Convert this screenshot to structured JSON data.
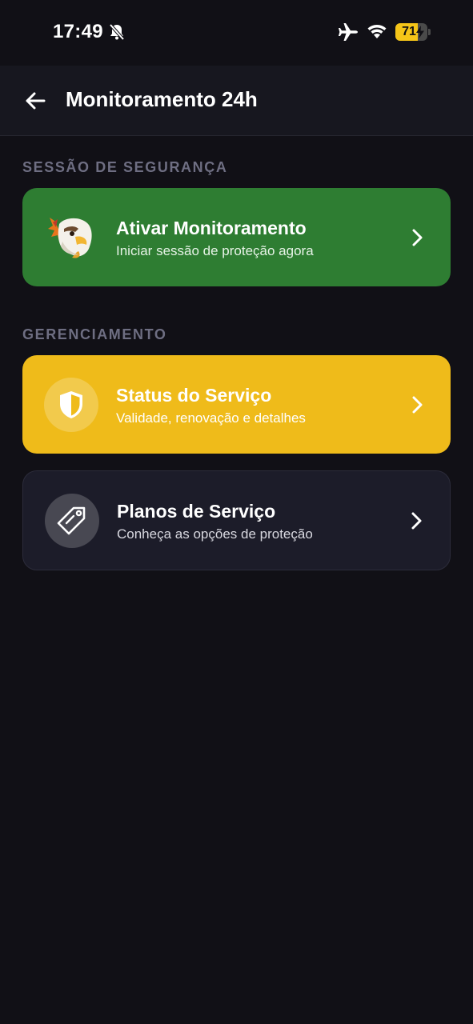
{
  "status_bar": {
    "time": "17:49",
    "battery_level": "71",
    "icons": [
      "bell-muted-icon",
      "airplane-icon",
      "wifi-icon",
      "battery-charging-icon"
    ]
  },
  "header": {
    "title": "Monitoramento 24h"
  },
  "sections": {
    "security": {
      "label": "SESSÃO DE SEGURANÇA",
      "card": {
        "title": "Ativar Monitoramento",
        "subtitle": "Iniciar sessão de proteção agora",
        "color": "#2e7d32",
        "icon": "eagle-logo-icon"
      }
    },
    "management": {
      "label": "GERENCIAMENTO",
      "cards": [
        {
          "title": "Status do Serviço",
          "subtitle": "Validade, renovação e detalhes",
          "color": "#efbb1a",
          "icon": "shield-icon"
        },
        {
          "title": "Planos de Serviço",
          "subtitle": "Conheça as opções de proteção",
          "color": "#1c1c29",
          "icon": "tag-icon"
        }
      ]
    }
  },
  "colors": {
    "background": "#111016",
    "header": "#17171f",
    "section_label": "#6e6e82",
    "battery": "#f5c518"
  }
}
